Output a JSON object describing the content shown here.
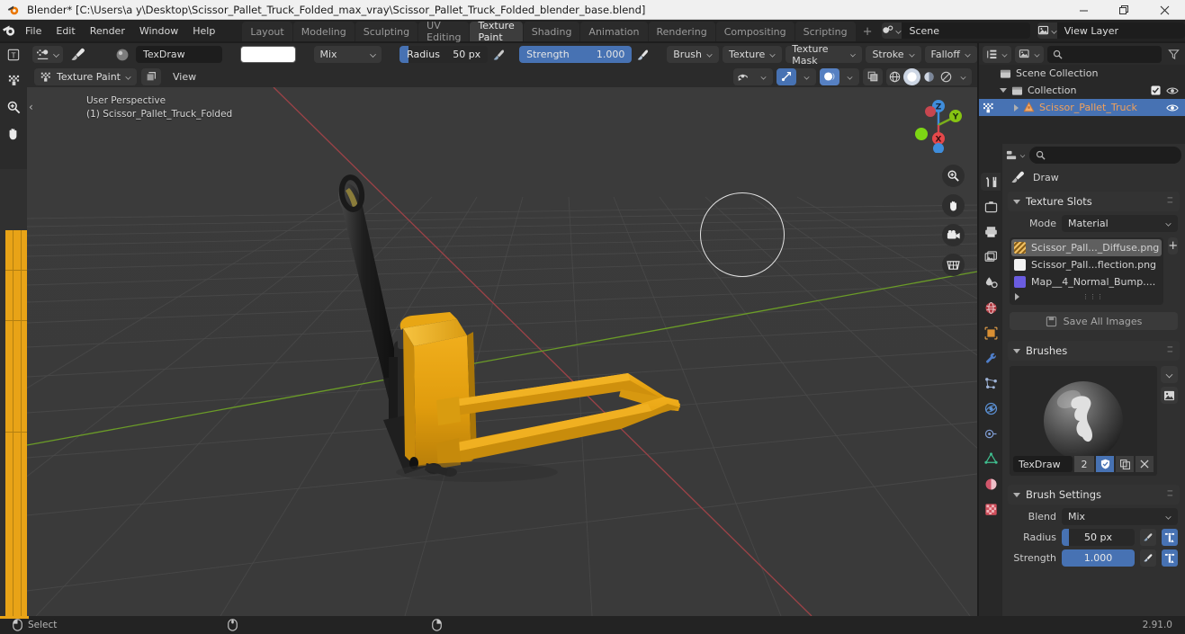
{
  "window": {
    "title": "Blender* [C:\\Users\\a y\\Desktop\\Scissor_Pallet_Truck_Folded_max_vray\\Scissor_Pallet_Truck_Folded_blender_base.blend]",
    "minimize": "—",
    "maximize": "❐",
    "close": "✕"
  },
  "topbar": {
    "menus": [
      "File",
      "Edit",
      "Render",
      "Window",
      "Help"
    ],
    "workspaces": [
      {
        "label": "Layout",
        "active": false
      },
      {
        "label": "Modeling",
        "active": false
      },
      {
        "label": "Sculpting",
        "active": false
      },
      {
        "label": "UV Editing",
        "active": false
      },
      {
        "label": "Texture Paint",
        "active": true
      },
      {
        "label": "Shading",
        "active": false
      },
      {
        "label": "Animation",
        "active": false
      },
      {
        "label": "Rendering",
        "active": false
      },
      {
        "label": "Compositing",
        "active": false
      },
      {
        "label": "Scripting",
        "active": false
      }
    ],
    "add_workspace": "+",
    "scene_name": "Scene",
    "view_layer_name": "View Layer",
    "new_copy": "⧉",
    "unlink": "✕"
  },
  "tool_settings": {
    "brush_name": "TexDraw",
    "color_hex": "#ffffff",
    "blend_mode": "Mix",
    "radius_label": "Radius",
    "radius_value": "50 px",
    "radius_fill_pct": 10,
    "strength_label": "Strength",
    "strength_value": "1.000",
    "strength_fill_pct": 100,
    "menus": [
      "Brush",
      "Texture",
      "Texture Mask",
      "Stroke",
      "Falloff"
    ]
  },
  "viewport_header": {
    "mode": "Texture Paint",
    "view_menu": "View"
  },
  "toolbar": {
    "tools": [
      {
        "name": "draw-tool",
        "active": true
      },
      {
        "name": "soften-tool",
        "active": false
      },
      {
        "name": "smear-tool",
        "active": false
      },
      {
        "name": "clone-tool",
        "active": false
      },
      {
        "name": "fill-tool",
        "active": false
      },
      {
        "name": "mask-tool",
        "active": false
      },
      {
        "name": "annotate-tool",
        "active": false
      }
    ]
  },
  "viewport": {
    "perspective_label": "User Perspective",
    "object_label": "(1) Scissor_Pallet_Truck_Folded",
    "gizmo_axes": [
      {
        "label": "Z",
        "color": "#2b8be8"
      },
      {
        "label": "Y",
        "color": "#86c412"
      },
      {
        "label": "X",
        "color": "#e5484a"
      }
    ],
    "nav_buttons": [
      "zoom-icon",
      "pan-hand-icon",
      "camera-icon",
      "grid-ortho-icon"
    ]
  },
  "outliner": {
    "display_mode": "view-layer-icon",
    "filter_icon": "filter-icon",
    "search_placeholder": "",
    "rows": [
      {
        "label": "Scene Collection",
        "icon": "collection-icon",
        "indent": 0,
        "selected": false,
        "has_checkbox": false,
        "has_eye": false,
        "expand": ""
      },
      {
        "label": "Collection",
        "icon": "collection-icon",
        "indent": 1,
        "selected": false,
        "has_checkbox": true,
        "has_eye": true,
        "expand": "down"
      },
      {
        "label": "Scissor_Pallet_Truck",
        "icon": "mesh-object-icon",
        "indent": 2,
        "selected": true,
        "has_checkbox": false,
        "has_eye": true,
        "expand": "right"
      }
    ]
  },
  "properties": {
    "tabs": [
      {
        "name": "tool-tab",
        "active": true,
        "color": "#d6d6d6"
      },
      {
        "name": "render-tab",
        "active": false,
        "color": "#c8c8c8"
      },
      {
        "name": "output-tab",
        "active": false,
        "color": "#c8c8c8"
      },
      {
        "name": "view-layer-tab",
        "active": false,
        "color": "#c8c8c8"
      },
      {
        "name": "scene-tab",
        "active": false,
        "color": "#c8c8c8"
      },
      {
        "name": "world-tab",
        "active": false,
        "color": "#e05a63"
      },
      {
        "name": "object-tab",
        "active": false,
        "color": "#e8a34b"
      },
      {
        "name": "modifier-tab",
        "active": false,
        "color": "#4f7ec9"
      },
      {
        "name": "particles-tab",
        "active": false,
        "color": "#9fb4d8"
      },
      {
        "name": "physics-tab",
        "active": false,
        "color": "#5a8ed0"
      },
      {
        "name": "constraints-tab",
        "active": false,
        "color": "#7d9ad0"
      },
      {
        "name": "data-tab",
        "active": false,
        "color": "#3fbf8f"
      },
      {
        "name": "material-tab",
        "active": false,
        "color": "#d1566b"
      },
      {
        "name": "texture-tab",
        "active": false,
        "color": "#d14f5c"
      }
    ],
    "search_placeholder": "",
    "breadcrumb": "Draw",
    "texture_slots": {
      "title": "Texture Slots",
      "mode_label": "Mode",
      "mode_value": "Material",
      "add_label": "+",
      "slots": [
        {
          "label": "Scissor_Pall..._Diffuse.png",
          "swatch": "#d8a33a",
          "selected": true
        },
        {
          "label": "Scissor_Pall...flection.png",
          "swatch": "#f2f2f2",
          "selected": false
        },
        {
          "label": "Map__4_Normal_Bump....",
          "swatch": "#6a5ce0",
          "selected": false
        }
      ],
      "save_all_label": "Save All Images"
    },
    "brushes": {
      "title": "Brushes",
      "brush_name": "TexDraw",
      "users_count": "2",
      "fake_user_icon": "shield-icon",
      "duplicate_icon": "copy-icon",
      "unlink_icon": "x-icon"
    },
    "brush_settings": {
      "title": "Brush Settings",
      "blend_label": "Blend",
      "blend_value": "Mix",
      "radius_label": "Radius",
      "radius_value": "50 px",
      "radius_fill_pct": 10,
      "strength_label": "Strength",
      "strength_value": "1.000",
      "strength_fill_pct": 100
    }
  },
  "statusbar": {
    "mouse_hint": "Select",
    "version": "2.91.0"
  }
}
